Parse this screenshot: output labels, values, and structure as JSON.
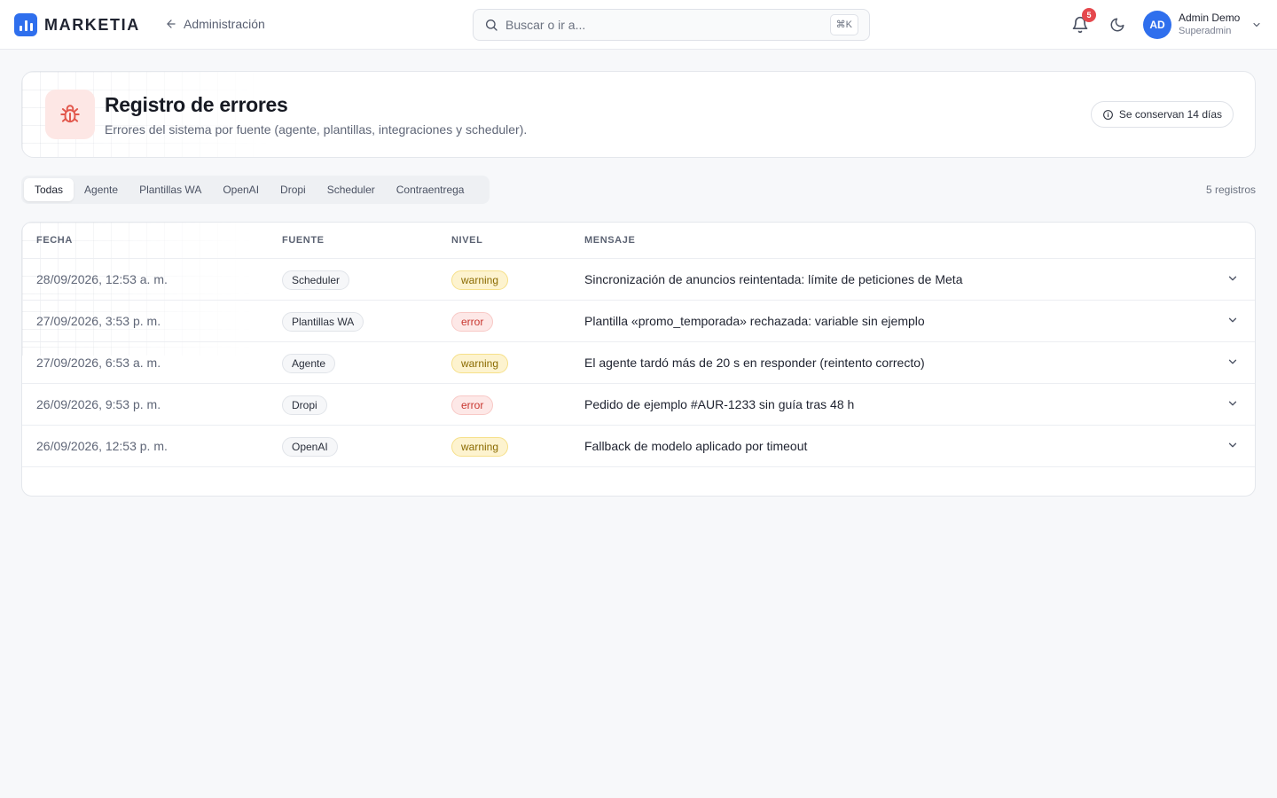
{
  "header": {
    "brand": "MARKETIA",
    "back_label": "Administración",
    "search_placeholder": "Buscar o ir a...",
    "search_shortcut": "⌘K",
    "notifications_count": "5",
    "user_initials": "AD",
    "user_name": "Admin Demo",
    "user_role": "Superadmin"
  },
  "page": {
    "title": "Registro de errores",
    "subtitle": "Errores del sistema por fuente (agente, plantillas, integraciones y scheduler).",
    "retention_label": "Se conservan 14 días"
  },
  "tabs": [
    {
      "label": "Todas",
      "active": true
    },
    {
      "label": "Agente",
      "active": false
    },
    {
      "label": "Plantillas WA",
      "active": false
    },
    {
      "label": "OpenAI",
      "active": false
    },
    {
      "label": "Dropi",
      "active": false
    },
    {
      "label": "Scheduler",
      "active": false
    },
    {
      "label": "Contraentrega",
      "active": false
    }
  ],
  "records_count": "5 registros",
  "table": {
    "columns": [
      "Fecha",
      "Fuente",
      "Nivel",
      "Mensaje"
    ],
    "rows": [
      {
        "date": "28/09/2026, 12:53 a. m.",
        "source": "Scheduler",
        "level": "warning",
        "message": "Sincronización de anuncios reintentada: límite de peticiones de Meta"
      },
      {
        "date": "27/09/2026, 3:53 p. m.",
        "source": "Plantillas WA",
        "level": "error",
        "message": "Plantilla «promo_temporada» rechazada: variable sin ejemplo"
      },
      {
        "date": "27/09/2026, 6:53 a. m.",
        "source": "Agente",
        "level": "warning",
        "message": "El agente tardó más de 20 s en responder (reintento correcto)"
      },
      {
        "date": "26/09/2026, 9:53 p. m.",
        "source": "Dropi",
        "level": "error",
        "message": "Pedido de ejemplo #AUR-1233 sin guía tras 48 h"
      },
      {
        "date": "26/09/2026, 12:53 p. m.",
        "source": "OpenAI",
        "level": "warning",
        "message": "Fallback de modelo aplicado por timeout"
      }
    ]
  },
  "colors": {
    "brand": "#2f6fed",
    "warning_bg": "#fdf3cf",
    "error_bg": "#fde8e7",
    "error_text": "#c8362f",
    "badge": "#e5484d"
  }
}
